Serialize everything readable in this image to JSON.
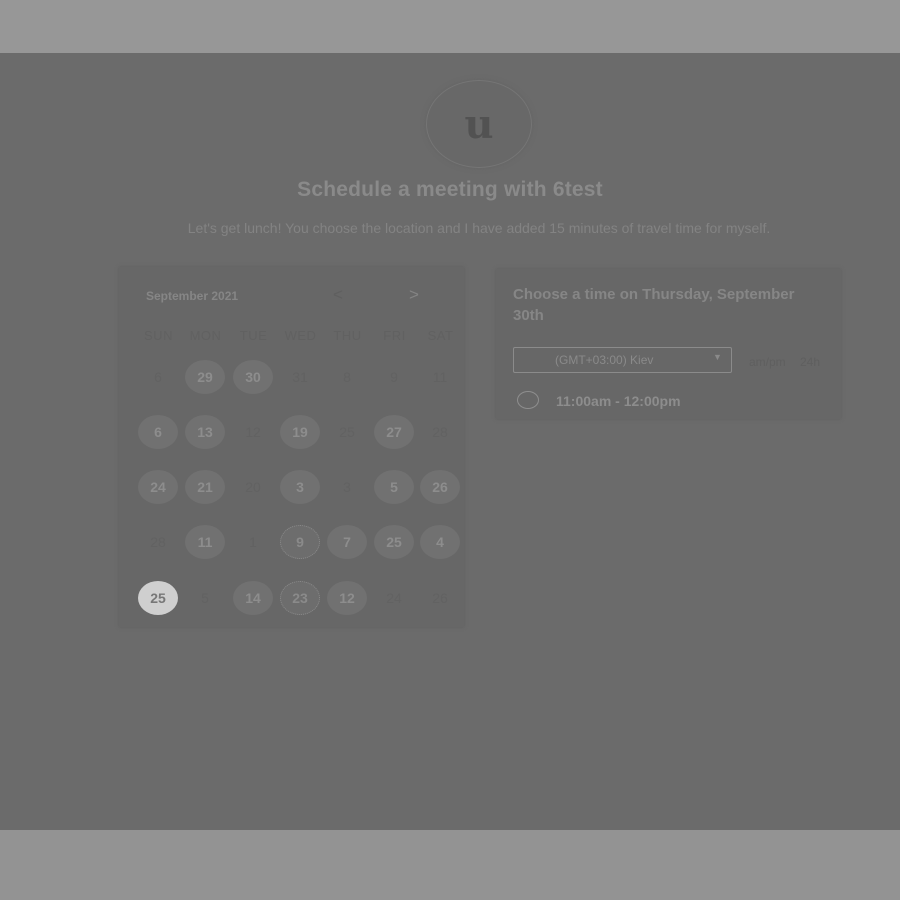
{
  "host": {
    "avatar_letter": "u",
    "title": "Schedule a meeting with 6test",
    "description": "Let's get lunch! You choose the location and I have added 15 minutes of travel time for myself."
  },
  "calendar": {
    "month": "September 2021",
    "prev_icon": "chevron-left-icon",
    "next_icon": "chevron-right-icon",
    "weekdays": [
      "SUN",
      "MON",
      "TUE",
      "WED",
      "THU",
      "FRI",
      "SAT"
    ],
    "weeks": [
      [
        {
          "d": "6",
          "s": "off"
        },
        {
          "d": "29",
          "s": "on"
        },
        {
          "d": "30",
          "s": "on"
        },
        {
          "d": "31",
          "s": "off"
        },
        {
          "d": "8",
          "s": "off"
        },
        {
          "d": "9",
          "s": "off"
        },
        {
          "d": "11",
          "s": "off"
        }
      ],
      [
        {
          "d": "6",
          "s": "on"
        },
        {
          "d": "13",
          "s": "on"
        },
        {
          "d": "12",
          "s": "off"
        },
        {
          "d": "19",
          "s": "on"
        },
        {
          "d": "25",
          "s": "off"
        },
        {
          "d": "27",
          "s": "on"
        },
        {
          "d": "28",
          "s": "off"
        }
      ],
      [
        {
          "d": "24",
          "s": "on"
        },
        {
          "d": "21",
          "s": "on"
        },
        {
          "d": "20",
          "s": "off"
        },
        {
          "d": "3",
          "s": "on"
        },
        {
          "d": "3",
          "s": "off"
        },
        {
          "d": "5",
          "s": "on"
        },
        {
          "d": "26",
          "s": "on"
        }
      ],
      [
        {
          "d": "28",
          "s": "off"
        },
        {
          "d": "11",
          "s": "on"
        },
        {
          "d": "1",
          "s": "off"
        },
        {
          "d": "9",
          "s": "dot"
        },
        {
          "d": "7",
          "s": "on"
        },
        {
          "d": "25",
          "s": "on"
        },
        {
          "d": "4",
          "s": "on"
        }
      ],
      [
        {
          "d": "25",
          "s": "sel"
        },
        {
          "d": "5",
          "s": "off"
        },
        {
          "d": "14",
          "s": "on"
        },
        {
          "d": "23",
          "s": "dot"
        },
        {
          "d": "12",
          "s": "on"
        },
        {
          "d": "24",
          "s": "off"
        },
        {
          "d": "26",
          "s": "off"
        }
      ]
    ]
  },
  "times": {
    "title": "Choose a time on Thursday, September 30th",
    "timezone": "(GMT+03:00) Kiev",
    "format_ampm": "am/pm",
    "format_24h": "24h",
    "slot": "11:00am - 12:00pm"
  }
}
